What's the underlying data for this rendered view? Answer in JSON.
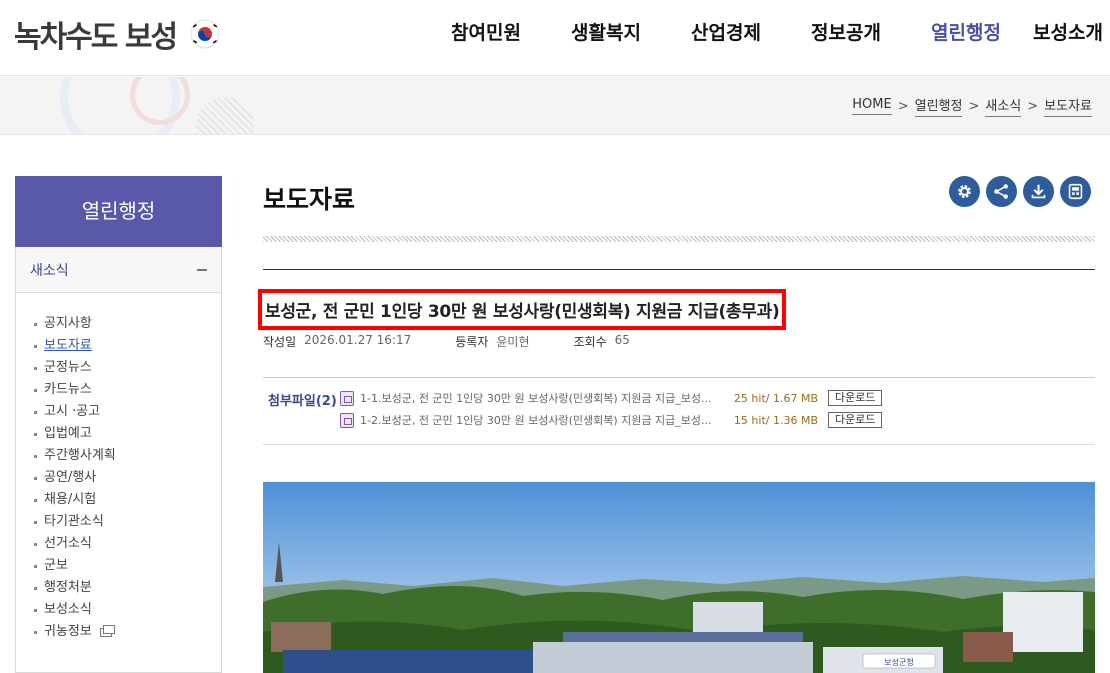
{
  "header": {
    "logo_text": "녹차수도 보성",
    "nav": [
      "참여민원",
      "생활복지",
      "산업경제",
      "정보공개",
      "열린행정",
      "보성소개"
    ]
  },
  "breadcrumb": [
    "HOME",
    "열린행정",
    "새소식",
    "보도자료"
  ],
  "sidebar": {
    "title": "열린행정",
    "section": "새소식",
    "items": [
      "공지사항",
      "보도자료",
      "군정뉴스",
      "카드뉴스",
      "고시 ·공고",
      "입법예고",
      "주간행사계획",
      "공연/행사",
      "채용/시험",
      "타기관소식",
      "선거소식",
      "군보",
      "행정처분",
      "보성소식",
      "귀농정보"
    ],
    "active_item": "보도자료"
  },
  "page": {
    "title": "보도자료",
    "tools": [
      "settings-icon",
      "share-icon",
      "download-icon",
      "print-icon"
    ]
  },
  "article": {
    "title": "보성군, 전 군민 1인당 30만 원 보성사랑(민생회복) 지원금 지급(총무과)",
    "date_label": "작성일",
    "date": "2026.01.27 16:17",
    "author_label": "등록자",
    "author": "윤미현",
    "views_label": "조회수",
    "views": "65",
    "attach_label": "첨부파일(2)",
    "files": [
      {
        "name": "1-1.보성군, 전 군민 1인당 30만 원 보성사랑(민생회복) 지원금 지급_보성...",
        "info": "25 hit/ 1.67 MB",
        "button": "다운로드"
      },
      {
        "name": "1-2.보성군, 전 군민 1인당 30만 원 보성사랑(민생회복) 지원금 지급_보성...",
        "info": "15 hit/ 1.36 MB",
        "button": "다운로드"
      }
    ],
    "photo_sign": "보성군청"
  }
}
